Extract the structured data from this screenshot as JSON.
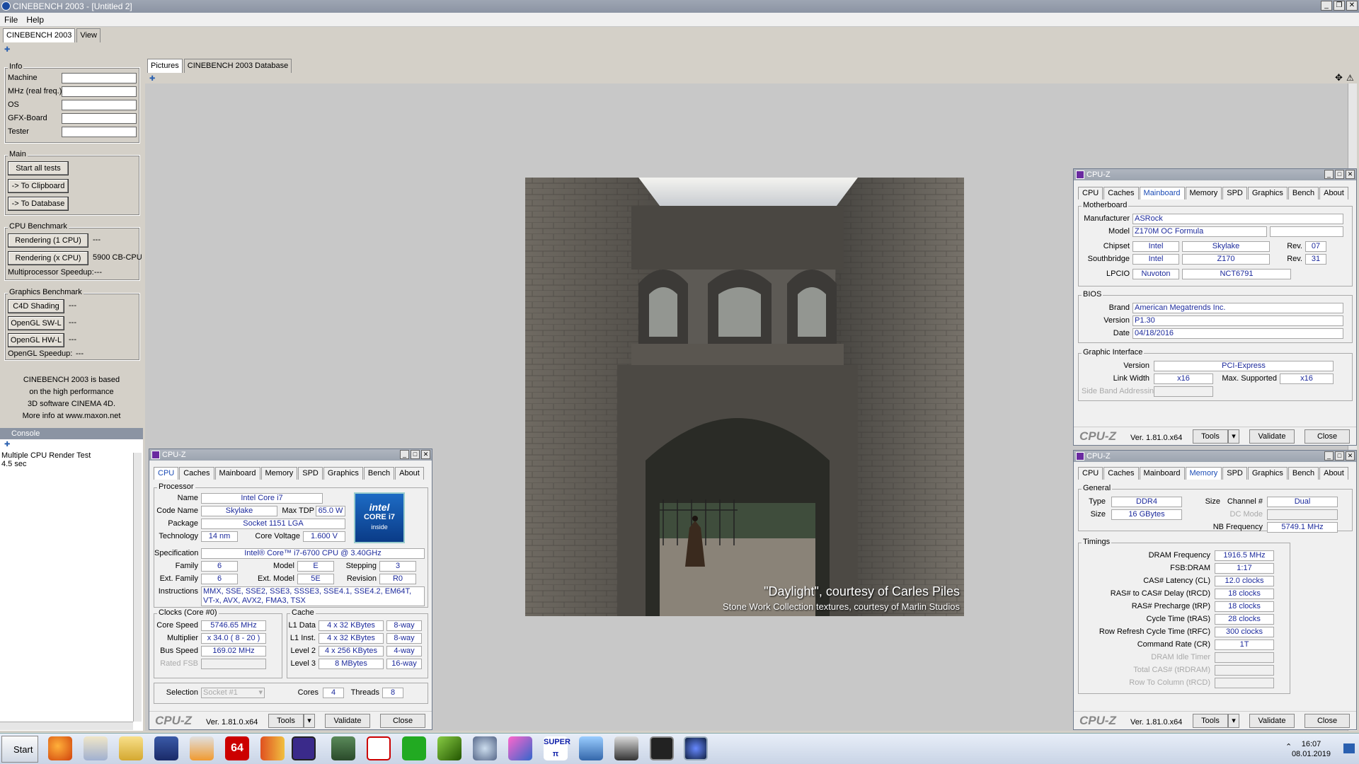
{
  "app": {
    "title": "CINEBENCH 2003 - [Untitled 2]",
    "menu": [
      "File",
      "Help"
    ],
    "tabs": [
      "CINEBENCH 2003",
      "View"
    ]
  },
  "left": {
    "info_title": "Info",
    "info_fields": [
      "Machine",
      "MHz (real freq.)",
      "OS",
      "GFX-Board",
      "Tester"
    ],
    "main_title": "Main",
    "btn_start": "Start all tests",
    "btn_clip": "-> To Clipboard",
    "btn_db": "-> To Database",
    "cpu_title": "CPU Benchmark",
    "btn_r1": "Rendering (1 CPU)",
    "r1_val": "---",
    "btn_rx": "Rendering (x CPU)",
    "rx_val": "5900 CB-CPU",
    "mp_label": "Multiprocessor Speedup:",
    "mp_val": "---",
    "gfx_title": "Graphics Benchmark",
    "btn_c4d": "C4D Shading",
    "c4d_val": "---",
    "btn_sw": "OpenGL SW-L",
    "sw_val": "---",
    "btn_hw": "OpenGL HW-L",
    "hw_val": "---",
    "ogl_label": "OpenGL Speedup:",
    "ogl_val": "---",
    "about": [
      "CINEBENCH 2003 is based",
      "on the high performance",
      "3D software CINEMA 4D.",
      "More info at www.maxon.net"
    ]
  },
  "console": {
    "title": "Console",
    "lines": [
      "Multiple CPU Render Test",
      "4.5 sec"
    ]
  },
  "main": {
    "tabs": [
      "Pictures",
      "CINEBENCH 2003 Database"
    ],
    "caption1": "\"Daylight\", courtesy of Carles Piles",
    "caption2": "Stone Work Collection textures, courtesy of Marlin Studios"
  },
  "cpuz_common": {
    "title": "CPU-Z",
    "tabs": [
      "CPU",
      "Caches",
      "Mainboard",
      "Memory",
      "SPD",
      "Graphics",
      "Bench",
      "About"
    ],
    "logo": "CPU-Z",
    "ver": "Ver. 1.81.0.x64",
    "tools": "Tools",
    "validate": "Validate",
    "close": "Close"
  },
  "cpuz_cpu": {
    "processor": "Processor",
    "name_l": "Name",
    "name": "Intel Core i7",
    "code_l": "Code Name",
    "code": "Skylake",
    "tdp_l": "Max TDP",
    "tdp": "65.0 W",
    "pkg_l": "Package",
    "pkg": "Socket 1151 LGA",
    "tech_l": "Technology",
    "tech": "14 nm",
    "cv_l": "Core Voltage",
    "cv": "1.600 V",
    "spec_l": "Specification",
    "spec": "Intel® Core™ i7-6700 CPU @ 3.40GHz",
    "fam_l": "Family",
    "fam": "6",
    "model_l": "Model",
    "model": "E",
    "step_l": "Stepping",
    "step": "3",
    "efam_l": "Ext. Family",
    "efam": "6",
    "emod_l": "Ext. Model",
    "emod": "5E",
    "rev_l": "Revision",
    "rev": "R0",
    "ins_l": "Instructions",
    "ins": "MMX, SSE, SSE2, SSE3, SSSE3, SSE4.1, SSE4.2, EM64T, VT-x, AVX, AVX2, FMA3, TSX",
    "clocks": "Clocks (Core #0)",
    "cs_l": "Core Speed",
    "cs": "5746.65 MHz",
    "mul_l": "Multiplier",
    "mul": "x 34.0 ( 8 - 20 )",
    "bus_l": "Bus Speed",
    "bus": "169.02 MHz",
    "fsb_l": "Rated FSB",
    "fsb": "",
    "cache": "Cache",
    "l1d_l": "L1 Data",
    "l1d": "4 x 32 KBytes",
    "l1d_w": "8-way",
    "l1i_l": "L1 Inst.",
    "l1i": "4 x 32 KBytes",
    "l1i_w": "8-way",
    "l2_l": "Level 2",
    "l2": "4 x 256 KBytes",
    "l2_w": "4-way",
    "l3_l": "Level 3",
    "l3": "8 MBytes",
    "l3_w": "16-way",
    "sel_l": "Selection",
    "sel": "Socket #1",
    "cores_l": "Cores",
    "cores": "4",
    "thr_l": "Threads",
    "thr": "8",
    "badge1": "intel",
    "badge2": "CORE i7",
    "badge3": "inside"
  },
  "cpuz_mb": {
    "mb": "Motherboard",
    "man_l": "Manufacturer",
    "man": "ASRock",
    "mod_l": "Model",
    "mod": "Z170M OC Formula",
    "chip_l": "Chipset",
    "chip1": "Intel",
    "chip2": "Skylake",
    "chip_rev_l": "Rev.",
    "chip_rev": "07",
    "sb_l": "Southbridge",
    "sb1": "Intel",
    "sb2": "Z170",
    "sb_rev_l": "Rev.",
    "sb_rev": "31",
    "lpc_l": "LPCIO",
    "lpc1": "Nuvoton",
    "lpc2": "NCT6791",
    "bios": "BIOS",
    "brand_l": "Brand",
    "brand": "American Megatrends Inc.",
    "ver_l": "Version",
    "ver": "P1.30",
    "date_l": "Date",
    "date": "04/18/2016",
    "gi": "Graphic Interface",
    "giv_l": "Version",
    "giv": "PCI-Express",
    "lw_l": "Link Width",
    "lw": "x16",
    "ms_l": "Max. Supported",
    "ms": "x16",
    "sba_l": "Side Band Addressing"
  },
  "cpuz_mem": {
    "gen": "General",
    "type_l": "Type",
    "type": "DDR4",
    "ch_l": "Channel #",
    "ch": "Dual",
    "size_l": "Size",
    "size": "16 GBytes",
    "dc_l": "DC Mode",
    "nb_l": "NB Frequency",
    "nb": "5749.1 MHz",
    "tim": "Timings",
    "rows": [
      {
        "l": "DRAM Frequency",
        "v": "1916.5 MHz",
        "d": false
      },
      {
        "l": "FSB:DRAM",
        "v": "1:17",
        "d": false
      },
      {
        "l": "CAS# Latency (CL)",
        "v": "12.0 clocks",
        "d": false
      },
      {
        "l": "RAS# to CAS# Delay (tRCD)",
        "v": "18 clocks",
        "d": false
      },
      {
        "l": "RAS# Precharge (tRP)",
        "v": "18 clocks",
        "d": false
      },
      {
        "l": "Cycle Time (tRAS)",
        "v": "28 clocks",
        "d": false
      },
      {
        "l": "Row Refresh Cycle Time (tRFC)",
        "v": "300 clocks",
        "d": false
      },
      {
        "l": "Command Rate (CR)",
        "v": "1T",
        "d": false
      },
      {
        "l": "DRAM Idle Timer",
        "v": "",
        "d": true
      },
      {
        "l": "Total CAS# (tRDRAM)",
        "v": "",
        "d": true
      },
      {
        "l": "Row To Column (tRCD)",
        "v": "",
        "d": true
      }
    ]
  },
  "taskbar": {
    "start": "Start",
    "time": "16:07",
    "date": "08.01.2019",
    "icon_labels": [
      "64",
      "SUPER π"
    ]
  }
}
